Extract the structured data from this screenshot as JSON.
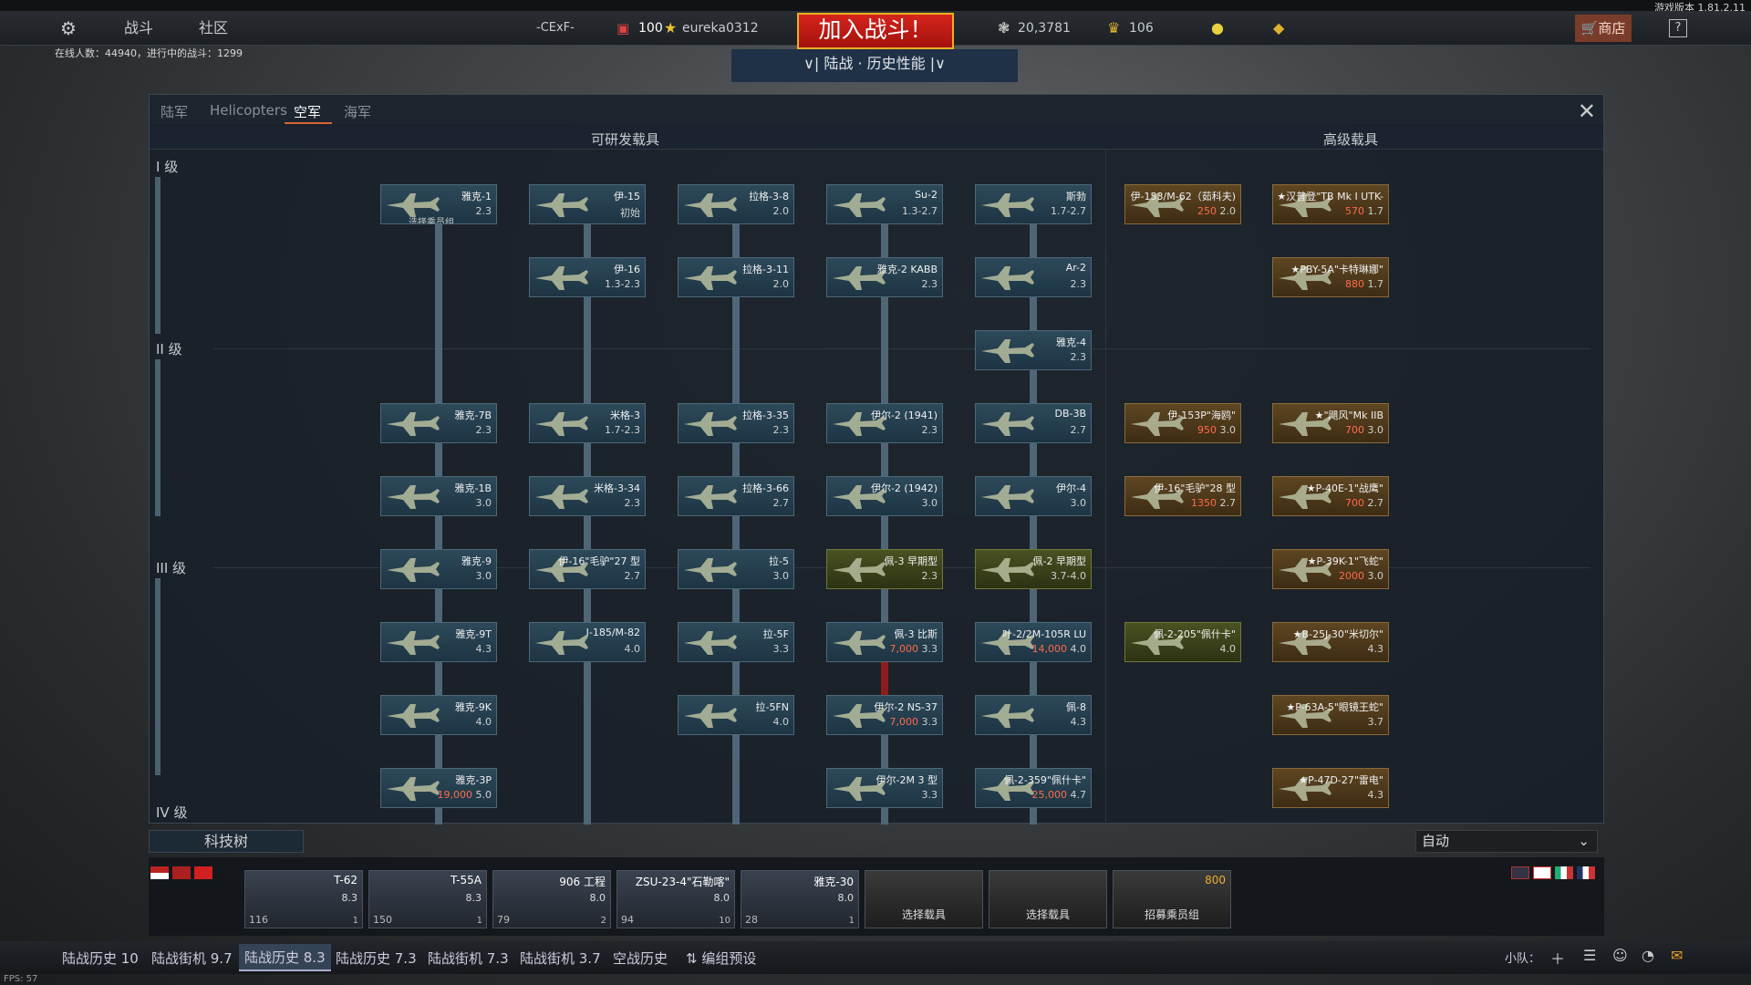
{
  "version": "游戏版本 1.81.2.11",
  "top": {
    "settings_icon": "gear-icon",
    "battles": "战斗",
    "community": "社区",
    "squad": "-CExF-",
    "rank_value": "100",
    "username": "eureka0312",
    "join": "加入战斗！",
    "mode": "∨| 陆战 · 历史性能 |∨",
    "silver": "20,3781",
    "gold": "106",
    "shop": "商店",
    "help": "?"
  },
  "online": "在线人数：44940，进行中的战斗：1299",
  "tabs": [
    "陆军",
    "Helicopters",
    "空军",
    "海军"
  ],
  "headers": {
    "research": "可研发载具",
    "premium": "高级载具"
  },
  "ranks": [
    "I 级",
    "II 级",
    "III 级",
    "IV 级"
  ],
  "cards": [
    {
      "n": "雅克-1",
      "b": "2.3",
      "x": 0,
      "y": 0,
      "ex": "选择乘员组"
    },
    {
      "n": "伊-15",
      "b": "初始",
      "x": 1,
      "y": 0
    },
    {
      "n": "拉格-3-8",
      "b": "2.0",
      "x": 2,
      "y": 0
    },
    {
      "n": "Su-2",
      "b": "1.3-2.7",
      "x": 3,
      "y": 0
    },
    {
      "n": "斯勃",
      "b": "1.7-2.7",
      "x": 4,
      "y": 0
    },
    {
      "n": "伊-16",
      "b": "1.3-2.3",
      "x": 1,
      "y": 1
    },
    {
      "n": "拉格-3-11",
      "b": "2.0",
      "x": 2,
      "y": 1
    },
    {
      "n": "雅克-2 KABB",
      "b": "2.3",
      "x": 3,
      "y": 1
    },
    {
      "n": "Ar-2",
      "b": "2.3",
      "x": 4,
      "y": 1
    },
    {
      "n": "雅克-4",
      "b": "2.3",
      "x": 4,
      "y": 2
    },
    {
      "n": "雅克-7B",
      "b": "2.3",
      "x": 0,
      "y": 3
    },
    {
      "n": "米格-3",
      "b": "1.7-2.3",
      "x": 1,
      "y": 3
    },
    {
      "n": "拉格-3-35",
      "b": "2.3",
      "x": 2,
      "y": 3
    },
    {
      "n": "伊尔-2 (1941)",
      "b": "2.3",
      "x": 3,
      "y": 3
    },
    {
      "n": "DB-3B",
      "b": "2.7",
      "x": 4,
      "y": 3
    },
    {
      "n": "雅克-1B",
      "b": "3.0",
      "x": 0,
      "y": 4
    },
    {
      "n": "米格-3-34",
      "b": "2.3",
      "x": 1,
      "y": 4
    },
    {
      "n": "拉格-3-66",
      "b": "2.7",
      "x": 2,
      "y": 4
    },
    {
      "n": "伊尔-2 (1942)",
      "b": "3.0",
      "x": 3,
      "y": 4
    },
    {
      "n": "伊尔-4",
      "b": "3.0",
      "x": 4,
      "y": 4
    },
    {
      "n": "雅克-9",
      "b": "3.0",
      "x": 0,
      "y": 5
    },
    {
      "n": "伊-16\"毛驴\"27 型",
      "b": "2.7",
      "x": 1,
      "y": 5
    },
    {
      "n": "拉-5",
      "b": "3.0",
      "x": 2,
      "y": 5
    },
    {
      "n": "佩-3 早期型",
      "b": "2.3",
      "x": 3,
      "y": 5
    },
    {
      "n": "佩-2 早期型",
      "b": "3.7-4.0",
      "x": 4,
      "y": 5
    },
    {
      "n": "雅克-9T",
      "b": "4.3",
      "x": 0,
      "y": 6
    },
    {
      "n": "I-185/M-82",
      "b": "4.0",
      "x": 1,
      "y": 6
    },
    {
      "n": "拉-5F",
      "b": "3.3",
      "x": 2,
      "y": 6
    },
    {
      "n": "佩-3 比斯",
      "b": "3.3",
      "rp": "7,000",
      "x": 3,
      "y": 6
    },
    {
      "n": "叶-2/2M-105R LU",
      "b": "4.0",
      "rp": "14,000",
      "x": 4,
      "y": 6
    },
    {
      "n": "雅克-9K",
      "b": "4.0",
      "x": 0,
      "y": 7
    },
    {
      "n": "拉-5FN",
      "b": "4.0",
      "x": 2,
      "y": 7
    },
    {
      "n": "伊尔-2 NS-37",
      "b": "3.3",
      "rp": "7,000",
      "x": 3,
      "y": 7
    },
    {
      "n": "佩-8",
      "b": "4.3",
      "x": 4,
      "y": 7
    },
    {
      "n": "雅克-3P",
      "b": "5.0",
      "rp": "19,000",
      "x": 0,
      "y": 8
    },
    {
      "n": "伊尔-2M 3 型",
      "b": "3.3",
      "x": 3,
      "y": 8
    },
    {
      "n": "佩-2-359\"佩什卡\"",
      "b": "4.7",
      "rp": "25,000",
      "x": 4,
      "y": 8
    }
  ],
  "premium": [
    {
      "n": "伊-153/M-62（茹科夫)",
      "g": "250",
      "b": "2.0",
      "x": 0,
      "y": 0
    },
    {
      "n": "★汉普登\"TB Mk I UTK-",
      "g": "570",
      "b": "1.7",
      "x": 1,
      "y": 0
    },
    {
      "n": "★PBY-5A\"卡特琳娜\"",
      "g": "880",
      "b": "1.7",
      "x": 1,
      "y": 1
    },
    {
      "n": "伊-153P\"海鸥\"",
      "g": "950",
      "b": "3.0",
      "x": 0,
      "y": 3
    },
    {
      "n": "★\"飓风\"Mk IIB",
      "g": "700",
      "b": "3.0",
      "x": 1,
      "y": 3
    },
    {
      "n": "伊-16\"毛驴\"28 型",
      "g": "1350",
      "b": "2.7",
      "x": 0,
      "y": 4
    },
    {
      "n": "★P-40E-1\"战鹰\"",
      "g": "700",
      "b": "2.7",
      "x": 1,
      "y": 4
    },
    {
      "n": "★P-39K-1\"飞蛇\"",
      "g": "2000",
      "b": "3.0",
      "x": 1,
      "y": 5
    },
    {
      "n": "佩-2-205\"佩什卡\"",
      "g": "",
      "b": "4.0",
      "x": 0,
      "y": 6,
      "olive": true
    },
    {
      "n": "★B-25J-30\"米切尔\"",
      "g": "",
      "b": "4.3",
      "x": 1,
      "y": 6
    },
    {
      "n": "★P-63A-5\"眼镜王蛇\"",
      "g": "",
      "b": "3.7",
      "x": 1,
      "y": 7
    },
    {
      "n": "★P-47D-27\"雷电\"",
      "g": "",
      "b": "4.3",
      "x": 1,
      "y": 8
    }
  ],
  "techtree": "科技树",
  "autoselect": "自动",
  "crew": [
    {
      "n": "T-62",
      "b": "8.3",
      "c": "116",
      "r": "1"
    },
    {
      "n": "T-55A",
      "b": "8.3",
      "c": "150",
      "r": "1"
    },
    {
      "n": "906 工程",
      "b": "8.0",
      "c": "79",
      "r": "2"
    },
    {
      "n": "ZSU-23-4\"石勒喀\"",
      "b": "8.0",
      "c": "94",
      "r": "10"
    },
    {
      "n": "雅克-30",
      "b": "8.0",
      "c": "28",
      "r": "1"
    }
  ],
  "crew_empty": [
    "选择载具",
    "选择载具",
    "招募乘员组"
  ],
  "crew_gold": "800",
  "presets": [
    "陆战历史 10",
    "陆战街机 9.7",
    "陆战历史 8.3",
    "陆战历史 7.3",
    "陆战街机 7.3",
    "陆战街机 3.7",
    "空战历史",
    "⇅ 编组预设"
  ],
  "squad_label": "小队：",
  "fps": "FPS: 57",
  "colors": {
    "accent": "#d8643a",
    "join": "#c41a14",
    "research_card": "#2d4a5a",
    "premium_card": "#5e4622"
  }
}
